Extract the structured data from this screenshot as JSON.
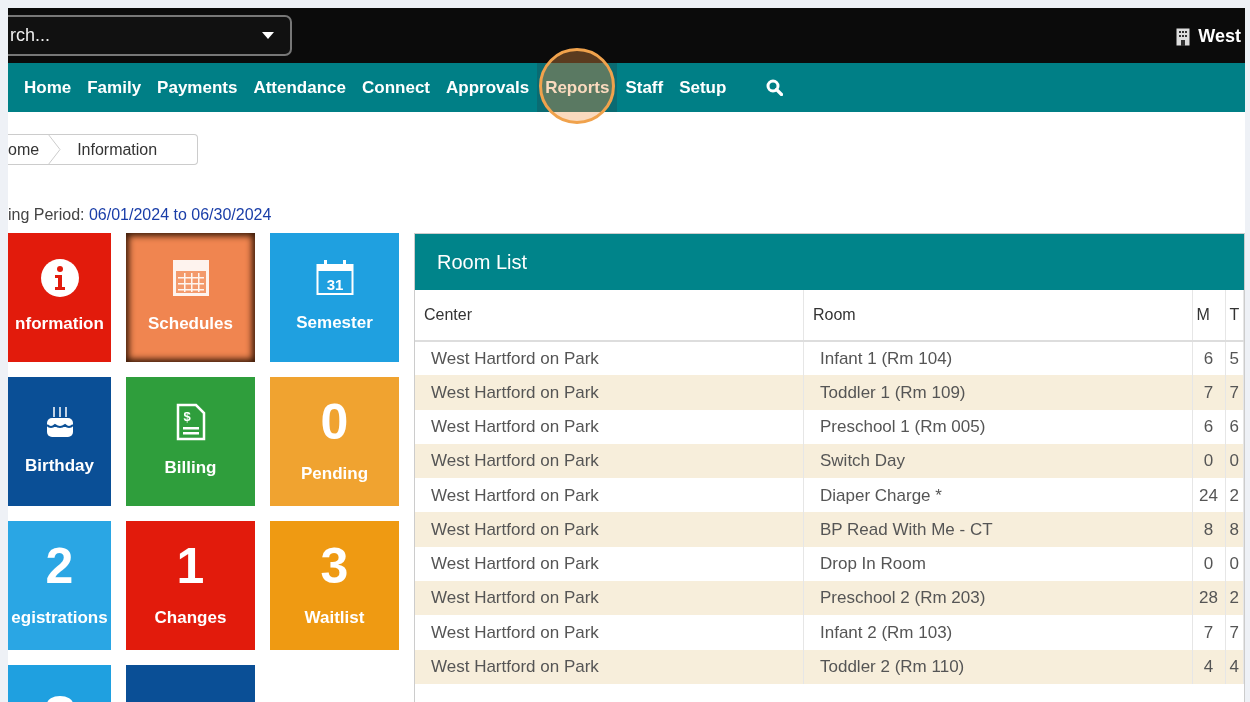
{
  "top_bar": {
    "search": {
      "placeholder": "rch..."
    },
    "center_name": "West"
  },
  "nav": {
    "items": [
      {
        "label": "Home",
        "selected": false
      },
      {
        "label": "Family",
        "selected": false
      },
      {
        "label": "Payments",
        "selected": false
      },
      {
        "label": "Attendance",
        "selected": false
      },
      {
        "label": "Connect",
        "selected": false
      },
      {
        "label": "Approvals",
        "selected": false
      },
      {
        "label": "Reports",
        "selected": true
      },
      {
        "label": "Staff",
        "selected": false
      },
      {
        "label": "Setup",
        "selected": false
      }
    ]
  },
  "breadcrumb": [
    "ome",
    "Information"
  ],
  "period": {
    "label": "ing Period:",
    "value": "06/01/2024 to 06/30/2024"
  },
  "tiles": [
    {
      "kind": "icon",
      "label": "nformation",
      "color": "#e21b0c",
      "selected": false
    },
    {
      "kind": "icon",
      "label": "Schedules",
      "color": "#f08550",
      "selected": true
    },
    {
      "kind": "icon",
      "icon_text": "31",
      "label": "Semester",
      "color": "#1fa0e0",
      "selected": false
    },
    {
      "kind": "icon",
      "label": "Birthday",
      "color": "#0a4f96",
      "selected": false
    },
    {
      "kind": "icon",
      "icon_text": "$",
      "label": "Billing",
      "color": "#2f9e3c",
      "selected": false
    },
    {
      "kind": "count",
      "count": "0",
      "label": "Pending",
      "color": "#f0a330",
      "selected": false
    },
    {
      "kind": "count",
      "count": "2",
      "label": "egistrations",
      "color": "#2aa6e4",
      "selected": false
    },
    {
      "kind": "count",
      "count": "1",
      "label": "Changes",
      "color": "#e21b0c",
      "selected": false
    },
    {
      "kind": "count",
      "count": "3",
      "label": "Waitlist",
      "color": "#ef9a12",
      "selected": false
    },
    {
      "kind": "partial",
      "color": "#1fa0e0",
      "selected": false
    },
    {
      "kind": "partial",
      "color": "#0a4f96",
      "selected": false
    }
  ],
  "room_list": {
    "title": "Room List",
    "columns": [
      "Center",
      "Room",
      "M",
      "T"
    ],
    "rows": [
      [
        "West Hartford on Park",
        "Infant 1 (Rm 104)",
        "6",
        "5"
      ],
      [
        "West Hartford on Park",
        "Toddler 1 (Rm 109)",
        "7",
        "7"
      ],
      [
        "West Hartford on Park",
        "Preschool 1 (Rm 005)",
        "6",
        "6"
      ],
      [
        "West Hartford on Park",
        "Switch Day",
        "0",
        "0"
      ],
      [
        "West Hartford on Park",
        "Diaper Charge *",
        "24",
        "2"
      ],
      [
        "West Hartford on Park",
        "BP Read With Me - CT",
        "8",
        "8"
      ],
      [
        "West Hartford on Park",
        "Drop In Room",
        "0",
        "0"
      ],
      [
        "West Hartford on Park",
        "Preschool 2 (Rm 203)",
        "28",
        "2"
      ],
      [
        "West Hartford on Park",
        "Infant 2 (Rm 103)",
        "7",
        "7"
      ],
      [
        "West Hartford on Park",
        "Toddler 2 (Rm 110)",
        "4",
        "4"
      ]
    ]
  }
}
